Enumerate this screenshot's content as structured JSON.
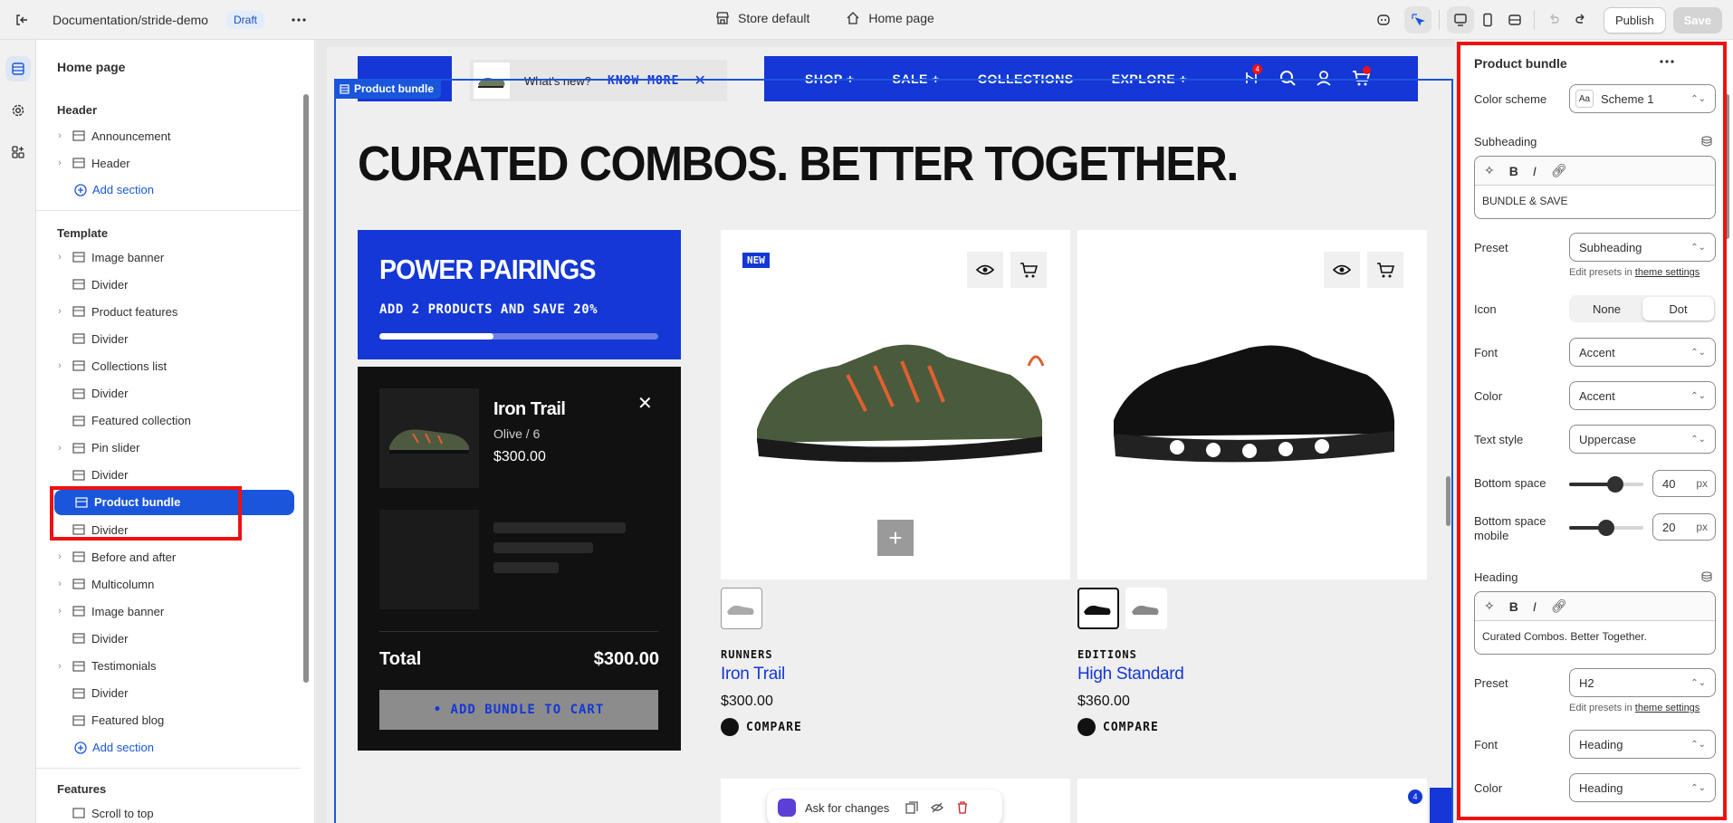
{
  "topbar": {
    "title": "Documentation/stride-demo",
    "badge": "Draft",
    "store": "Store default",
    "page": "Home page",
    "publish": "Publish",
    "save": "Save"
  },
  "left": {
    "title": "Home page",
    "header_group": "Header",
    "header_items": [
      "Announcement",
      "Header"
    ],
    "add_section": "Add section",
    "template_group": "Template",
    "template_items": [
      "Image banner",
      "Divider",
      "Product features",
      "Divider",
      "Collections list",
      "Divider",
      "Featured collection",
      "Pin slider",
      "Divider",
      "Product bundle",
      "Divider",
      "Before and after",
      "Multicolumn",
      "Image banner",
      "Divider",
      "Testimonials",
      "Divider",
      "Featured blog"
    ],
    "features_group": "Features",
    "features_items": [
      "Scroll to top"
    ]
  },
  "canvas": {
    "section_tag": "Product bundle",
    "announcement_text": "What's new?",
    "announcement_link": "KNOW MORE",
    "nav": [
      "SHOP +",
      "SALE +",
      "COLLECTIONS",
      "EXPLORE +"
    ],
    "compare_count": "4",
    "headline": "CURATED COMBOS. BETTER TOGETHER.",
    "bundle_title": "POWER PAIRINGS",
    "bundle_subtitle": "ADD 2 PRODUCTS AND SAVE 20%",
    "bundle_progress": 0.41,
    "bundle_item_name": "Iron Trail",
    "bundle_item_variant": "Olive / 6",
    "bundle_item_price": "$300.00",
    "total_label": "Total",
    "total_value": "$300.00",
    "add_bundle": "• ADD BUNDLE TO CART",
    "products": [
      {
        "badge": "NEW",
        "category": "RUNNERS",
        "name": "Iron Trail",
        "price": "$300.00",
        "compare": "COMPARE"
      },
      {
        "badge": "",
        "category": "EDITIONS",
        "name": "High Standard",
        "price": "$360.00",
        "compare": "COMPARE"
      }
    ],
    "ask": "Ask for changes",
    "mini_badge": "4"
  },
  "right": {
    "title": "Product bundle",
    "color_scheme_label": "Color scheme",
    "color_scheme_value": "Scheme 1",
    "subheading_label": "Subheading",
    "subheading_value": "BUNDLE & SAVE",
    "preset_label": "Preset",
    "preset_value": "Subheading",
    "edit_presets": "Edit presets in",
    "theme_settings": "theme settings",
    "icon_label": "Icon",
    "icon_none": "None",
    "icon_dot": "Dot",
    "font_label": "Font",
    "font_value": "Accent",
    "color_label": "Color",
    "color_value": "Accent",
    "text_style_label": "Text style",
    "text_style_value": "Uppercase",
    "bottom_space_label": "Bottom space",
    "bottom_space_value": "40",
    "bottom_space_level": 0.62,
    "bottom_space_mobile_label": "Bottom space mobile",
    "bottom_space_mobile_value": "20",
    "bottom_space_mobile_level": 0.5,
    "unit": "px",
    "heading_label": "Heading",
    "heading_value": "Curated Combos. Better Together.",
    "preset2_value": "H2",
    "font2_value": "Heading",
    "color2_value": "Heading"
  },
  "colors": {
    "brand_blue": "#1437d6",
    "admin_blue": "#1a56db",
    "highlight_red": "#e11"
  }
}
